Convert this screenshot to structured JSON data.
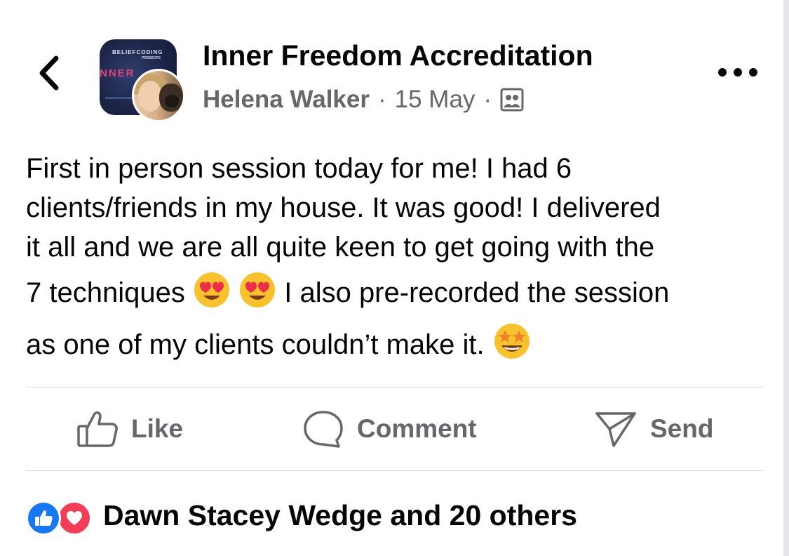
{
  "header": {
    "group_name": "Inner Freedom Accreditation",
    "author": "Helena Walker",
    "separator": "·",
    "date": "15 May",
    "visibility_icon": "group-members-icon",
    "group_avatar": {
      "top_text": "BELIEFCODING",
      "sub_text": "PRESENTS",
      "word": "NNER"
    }
  },
  "post": {
    "lines": [
      "First in person session today for me! I had 6",
      "clients/friends in my house. It was good! I delivered",
      "it all and we are all quite keen to get going with the"
    ],
    "line4_before": "7 techniques",
    "line4_after": "I also pre-recorded the session",
    "line5": "as one of my clients couldn’t make it.",
    "emojis": [
      "heart-eyes",
      "heart-eyes",
      "star-struck"
    ]
  },
  "actions": {
    "like": "Like",
    "comment": "Comment",
    "send": "Send"
  },
  "reactions": {
    "summary": "Dawn Stacey Wedge and 20 others",
    "types": [
      "like",
      "love"
    ]
  },
  "colors": {
    "primary_text": "#050505",
    "secondary_text": "#65676b",
    "like_blue": "#1877f2",
    "love_red": "#f33e58",
    "divider": "#d8dadf"
  }
}
